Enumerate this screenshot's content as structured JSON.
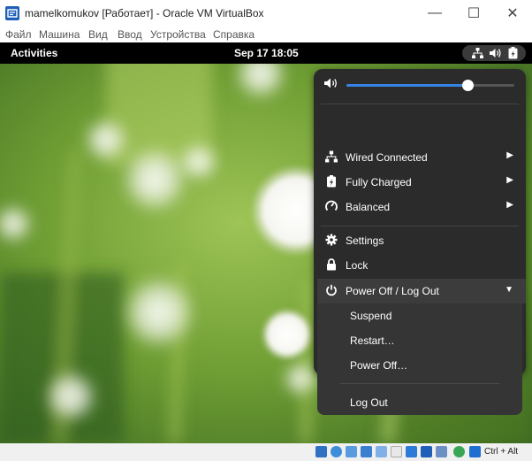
{
  "window": {
    "title": "mamelkomukov [Работает] - Oracle VM VirtualBox",
    "minimize": "—",
    "maximize": "☐",
    "close": "✕"
  },
  "menubar": [
    "Файл",
    "Машина",
    "Вид",
    "Ввод",
    "Устройства",
    "Справка"
  ],
  "gnome_topbar": {
    "activities": "Activities",
    "clock": "Sep 17  18:05",
    "tray_icons": [
      "network-icon",
      "volume-icon",
      "battery-icon"
    ]
  },
  "quick_settings": {
    "volume_level": 0.72,
    "items": [
      {
        "icon": "network-wired-icon",
        "label": "Wired Connected",
        "has_arrow": true
      },
      {
        "icon": "battery-full-icon",
        "label": "Fully Charged",
        "has_arrow": true
      },
      {
        "icon": "power-profile-icon",
        "label": "Balanced",
        "has_arrow": true
      }
    ],
    "actions": [
      {
        "icon": "gear-icon",
        "label": "Settings"
      },
      {
        "icon": "lock-icon",
        "label": "Lock"
      }
    ],
    "power": {
      "icon": "power-icon",
      "label": "Power Off / Log Out",
      "submenu": [
        "Suspend",
        "Restart…",
        "Power Off…",
        "Log Out"
      ]
    }
  },
  "statusbar": {
    "host_key": "Ctrl + Alt"
  },
  "colors": {
    "accent": "#3584e4",
    "menu_bg": "#2b2b2b",
    "topbar_bg": "#000000"
  }
}
